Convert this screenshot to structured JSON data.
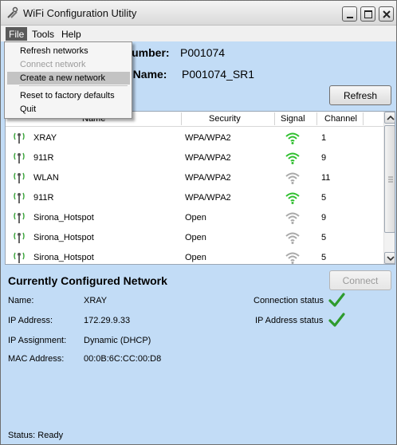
{
  "window": {
    "title": "WiFi Configuration Utility"
  },
  "menu": {
    "file": "File",
    "tools": "Tools",
    "help": "Help",
    "file_items": [
      "Refresh networks",
      "Connect network",
      "Create a new network",
      "Reset to factory defaults",
      "Quit"
    ]
  },
  "device": {
    "number_label": "Number:",
    "number_value": "P001074",
    "name_label": "y Name:",
    "name_value": "P001074_SR1"
  },
  "buttons": {
    "refresh": "Refresh",
    "connect": "Connect"
  },
  "networks": {
    "columns": [
      "Name",
      "Security",
      "Signal",
      "Channel"
    ],
    "rows": [
      {
        "name": "XRAY",
        "security": "WPA/WPA2",
        "channel": "1",
        "signal": "strong"
      },
      {
        "name": "911R",
        "security": "WPA/WPA2",
        "channel": "9",
        "signal": "strong"
      },
      {
        "name": "WLAN",
        "security": "WPA/WPA2",
        "channel": "11",
        "signal": "weak"
      },
      {
        "name": "911R",
        "security": "WPA/WPA2",
        "channel": "5",
        "signal": "strong"
      },
      {
        "name": "Sirona_Hotspot",
        "security": "Open",
        "channel": "9",
        "signal": "weak"
      },
      {
        "name": "Sirona_Hotspot",
        "security": "Open",
        "channel": "5",
        "signal": "weak"
      },
      {
        "name": "Sirona_Hotspot",
        "security": "Open",
        "channel": "5",
        "signal": "weak"
      }
    ]
  },
  "current": {
    "title": "Currently Configured Network",
    "name_label": "Name:",
    "name_value": "XRAY",
    "ip_label": "IP Address:",
    "ip_value": "172.29.9.33",
    "assign_label": "IP Assignment:",
    "assign_value": "Dynamic (DHCP)",
    "mac_label": "MAC Address:",
    "mac_value": "00:0B:6C:CC:00:D8",
    "conn_status_label": "Connection status",
    "ip_status_label": "IP Address status"
  },
  "status": {
    "text": "Status:  Ready"
  },
  "colors": {
    "signal_strong": "#2fbf2f",
    "signal_weak": "#a9a9a9",
    "check": "#2e9b2e",
    "background": "#c2dcf6"
  }
}
